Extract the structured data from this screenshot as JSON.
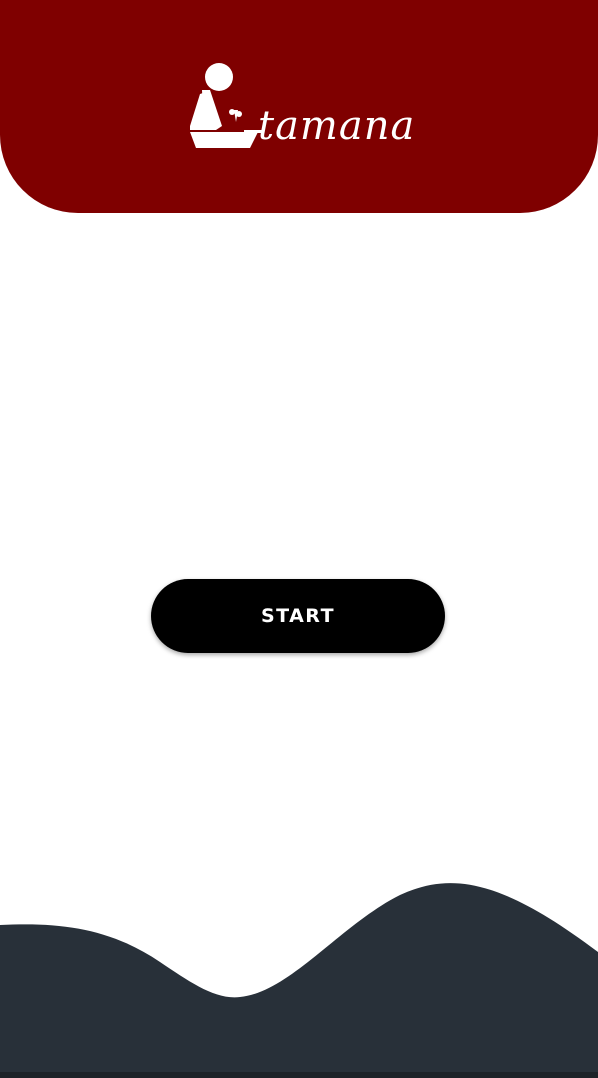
{
  "header": {
    "background_color": "#7f0000",
    "logo": {
      "icon": "person-at-desk-icon",
      "text": "tamana"
    }
  },
  "main": {
    "start_label": "START"
  },
  "footer": {
    "wave_color": "#283039"
  }
}
